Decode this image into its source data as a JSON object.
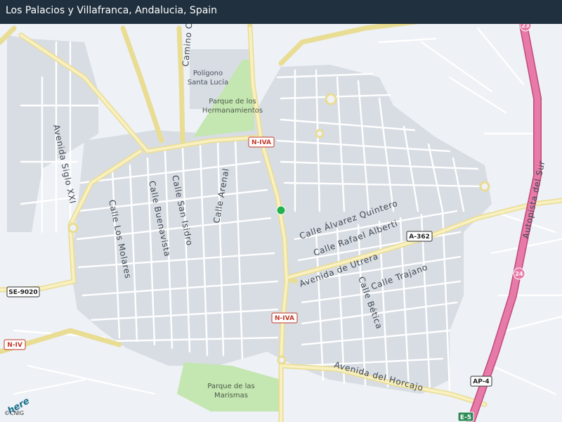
{
  "header": {
    "title": "Los Palacios y Villafranca, Andalucia, Spain"
  },
  "places": {
    "poligono": [
      "Polígono",
      "Santa Lucía"
    ],
    "parque_hermanamientos": [
      "Parque de los",
      "Hermanamientos"
    ],
    "parque_marismas": [
      "Parque de las",
      "Marismas"
    ]
  },
  "streets": {
    "avenida_siglo_xxi": "Avenida  Siglo  XXI",
    "camino": "Camino  C",
    "calle_los_molares": "Calle  Los  Molares",
    "calle_buenavista": "Calle  Buenavista",
    "calle_san_isidro": "Calle  San  Isidro",
    "calle_arenal": "Calle  Arenal",
    "calle_alvarez_quintero": "Calle  Álvarez  Quintero",
    "calle_rafael_alberti": "Calle  Rafael  Alberti",
    "avenida_de_utrera": "Avenida  de  Utrera",
    "calle_trajano": "Calle  Trajano",
    "calle_betica": "Calle  Bética",
    "avenida_del_horcajo": "Avenida  del  Horcajo",
    "autopista_del_sur": "Autopista  del  Sur"
  },
  "shields": {
    "n_iva_top": "N-IVA",
    "n_iva_bottom": "N-IVA",
    "a_362": "A-362",
    "se_9020": "SE-9020",
    "n_iv": "N-IV",
    "ap_4": "AP-4",
    "e_5": "E-5",
    "route_23": "23",
    "route_24": "24"
  },
  "marker": {
    "color": "#22b14c"
  },
  "colors": {
    "background": "#eef1f5",
    "urban": "#d8dde3",
    "park": "#c4e6b0",
    "motorway": "#e06a9a",
    "main_road": "#f3e8a6",
    "title_bar": "#20303e"
  },
  "attribution": {
    "logo": "here",
    "copyright": "©CNIG"
  }
}
